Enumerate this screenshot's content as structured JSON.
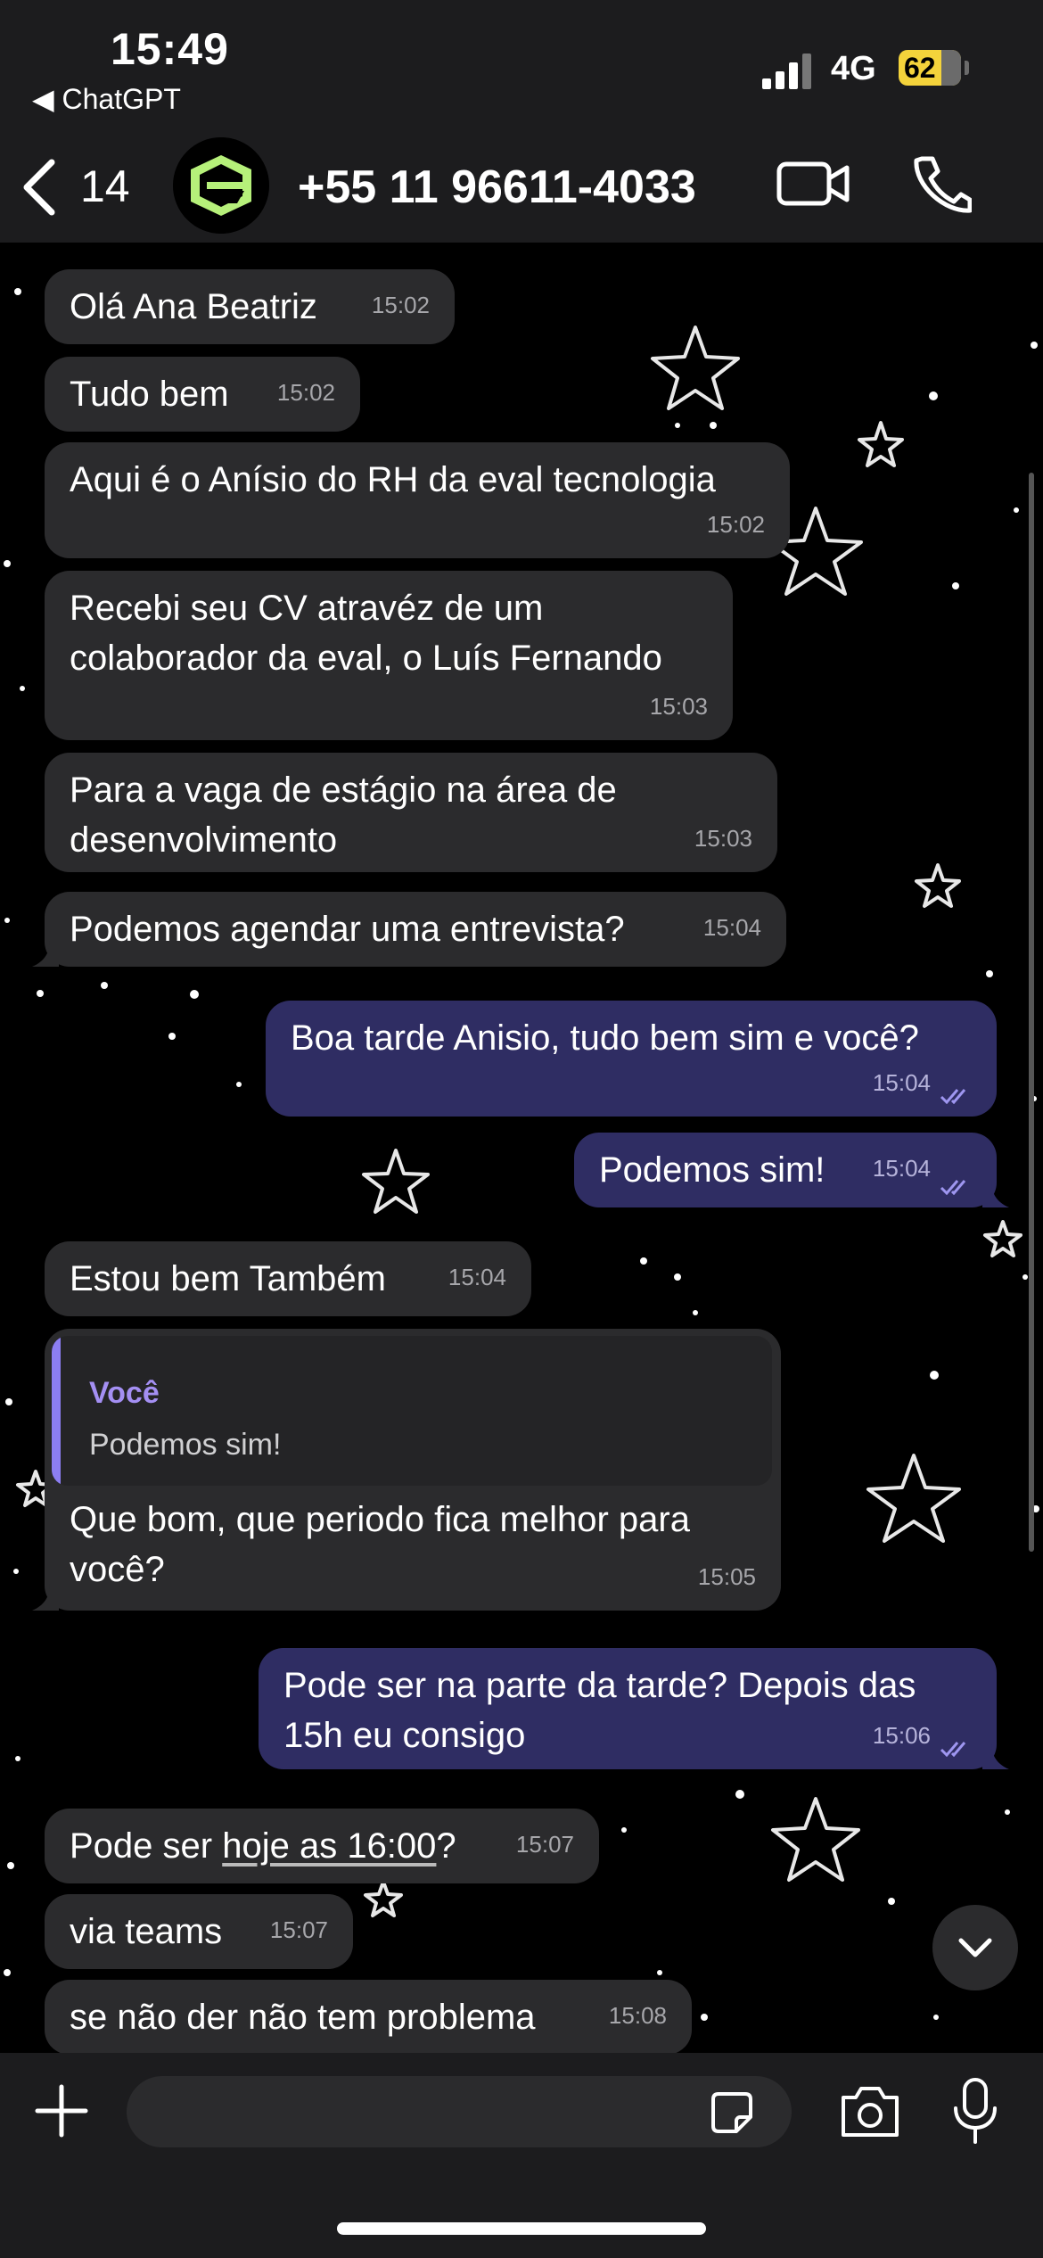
{
  "status_bar": {
    "time": "15:49",
    "back_app": "◀ ChatGPT",
    "network": "4G",
    "battery": "62"
  },
  "header": {
    "unread_count": "14",
    "contact_name": "+55 11 96611-4033"
  },
  "messages": [
    {
      "dir": "in",
      "text": "Olá Ana Beatriz",
      "time": "15:02"
    },
    {
      "dir": "in",
      "text": "Tudo bem",
      "time": "15:02"
    },
    {
      "dir": "in",
      "text": "Aqui é o Anísio do RH da eval tecnologia",
      "time": "15:02"
    },
    {
      "dir": "in",
      "text": "Recebi seu CV atravéz de um\ncolaborador da eval, o Luís Fernando",
      "time": "15:03"
    },
    {
      "dir": "in",
      "text": "Para a vaga de estágio na área de\ndesenvolvimento",
      "time": "15:03"
    },
    {
      "dir": "in",
      "text": "Podemos agendar uma entrevista?",
      "time": "15:04"
    },
    {
      "dir": "out",
      "text": "Boa tarde Anisio, tudo bem sim e você?",
      "time": "15:04"
    },
    {
      "dir": "out",
      "text": "Podemos sim!",
      "time": "15:04"
    },
    {
      "dir": "in",
      "text": "Estou bem Também",
      "time": "15:04"
    },
    {
      "dir": "in",
      "quote_author": "Você",
      "quote_text": "Podemos sim!",
      "text": "Que bom, que periodo fica melhor para\nvocê?",
      "time": "15:05"
    },
    {
      "dir": "out",
      "text": "Pode ser na parte da tarde? Depois das\n15h eu consigo",
      "time": "15:06"
    },
    {
      "dir": "in",
      "text_prefix": "Pode ser ",
      "text_link": "hoje as 16:00",
      "text_suffix": "?",
      "time": "15:07"
    },
    {
      "dir": "in",
      "text": "via teams",
      "time": "15:07"
    },
    {
      "dir": "in",
      "text": "se não der não tem problema",
      "time": "15:08"
    }
  ],
  "colors": {
    "incoming_bubble": "#2b2b2d",
    "outgoing_bubble": "#2f2d63",
    "quote_accent": "#8c7ef2",
    "battery": "#f4d33b"
  },
  "icons": [
    "back-chevron-icon",
    "avatar-logo-icon",
    "video-call-icon",
    "phone-call-icon",
    "double-check-icon",
    "chevron-down-icon",
    "plus-icon",
    "sticker-icon",
    "camera-icon",
    "microphone-icon"
  ]
}
